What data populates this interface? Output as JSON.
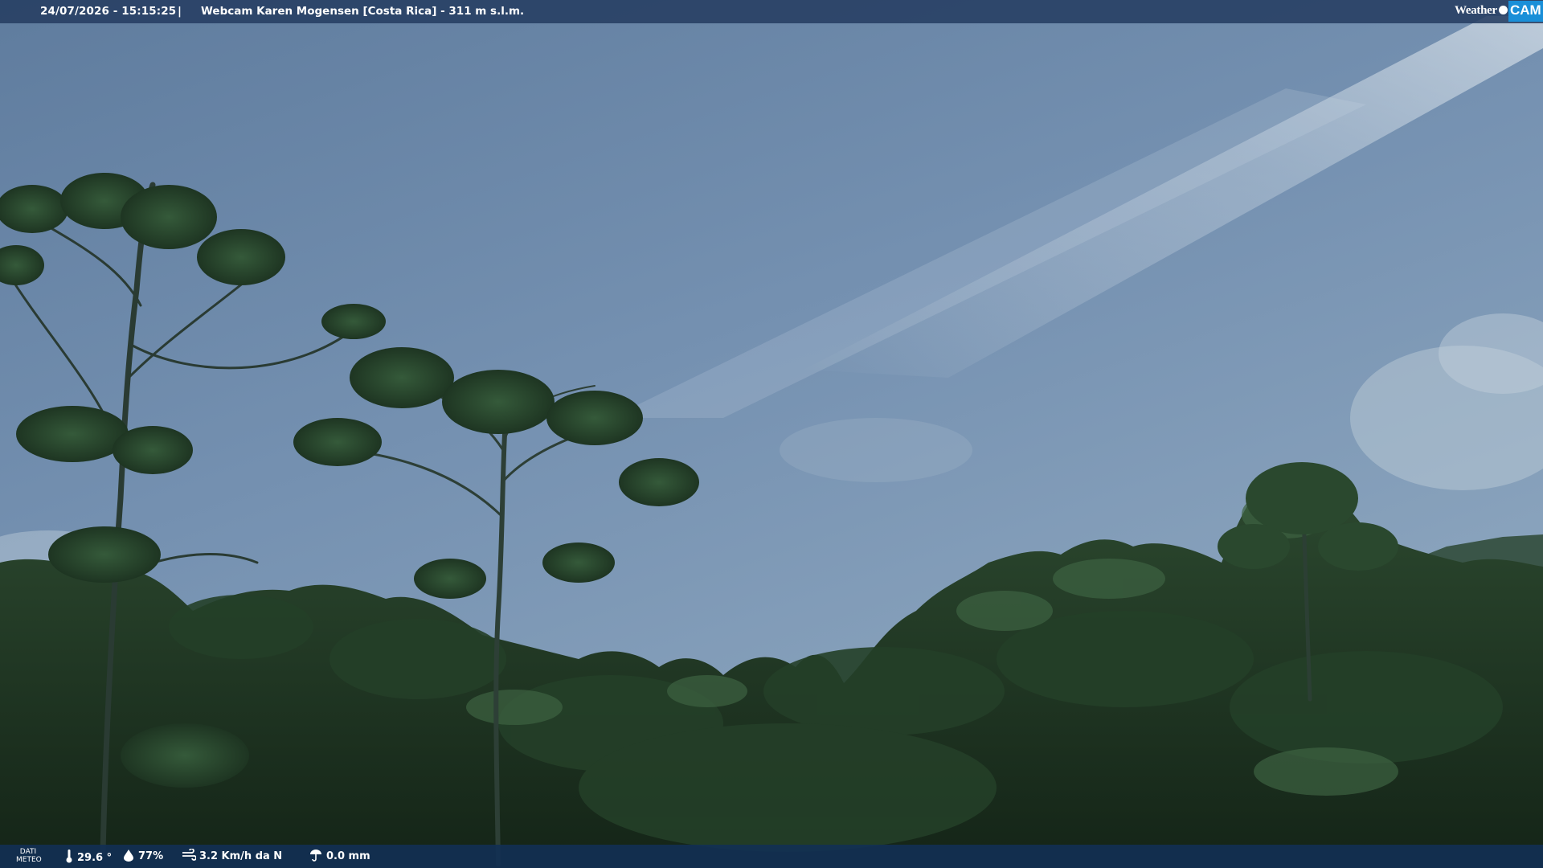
{
  "header": {
    "datetime": "24/07/2026 - 15:15:25",
    "separator": "|",
    "title": "Webcam Karen Mogensen [Costa Rica]  - 311 m s.l.m.",
    "logo_text_weather": "Weather",
    "logo_text_cam": "CAM"
  },
  "footer": {
    "label_line1": "DATI",
    "label_line2": "METEO",
    "temperature": "29.6 °",
    "temperature_icon": "thermometer-icon",
    "humidity": "77%",
    "humidity_icon": "humidity-icon",
    "wind": "3.2 Km/h da N",
    "wind_icon": "wind-icon",
    "rain": "0.0 mm",
    "rain_icon": "rain-icon"
  },
  "colors": {
    "sky_top": "#6a86a8",
    "sky_bottom": "#8ea8c0",
    "foliage_dark": "#17281b",
    "foliage_mid": "#2a4a2c",
    "header_bar": "#263e62",
    "footer_bar": "#123054",
    "logo_accent": "#1a8fd8"
  }
}
